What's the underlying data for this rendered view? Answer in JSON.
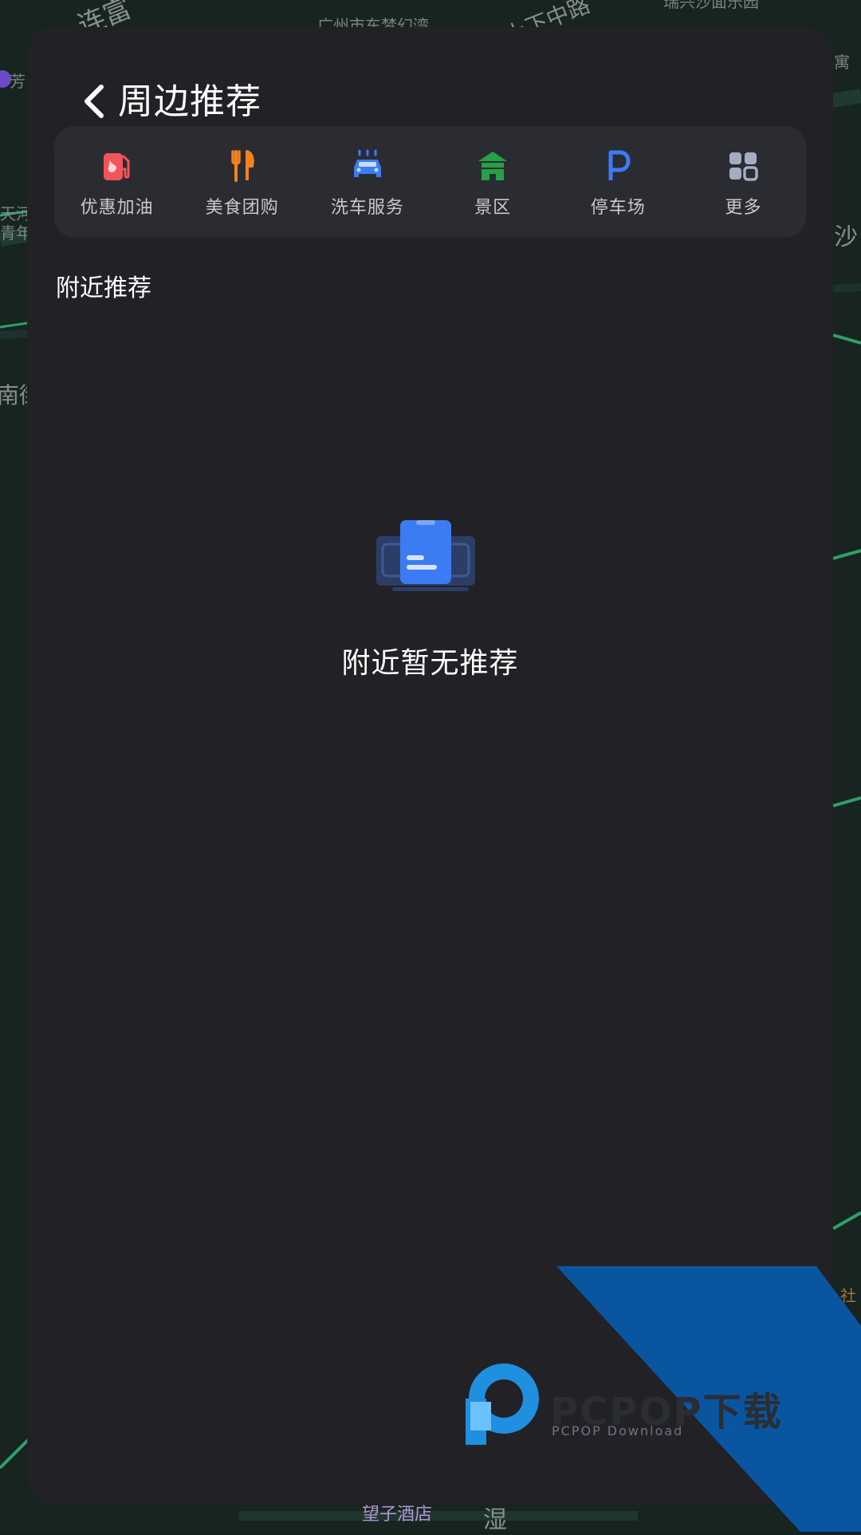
{
  "map": {
    "labels": [
      "连富",
      "广州市东梦幻湾",
      "上下中路",
      "瑞兴沙面乐园",
      "芳",
      "寓",
      "天河",
      "青年",
      "南街",
      "沙",
      "社",
      "湿",
      "望子酒店"
    ]
  },
  "header": {
    "back_icon": "chevron-left-icon",
    "title": "周边推荐"
  },
  "categories": [
    {
      "label": "优惠加油",
      "icon": "fuel-pump-icon",
      "color": "#f2545b"
    },
    {
      "label": "美食团购",
      "icon": "fork-knife-icon",
      "color": "#f5821f"
    },
    {
      "label": "洗车服务",
      "icon": "car-wash-icon",
      "color": "#3b7cf5"
    },
    {
      "label": "景区",
      "icon": "pavilion-icon",
      "color": "#27a047"
    },
    {
      "label": "停车场",
      "icon": "parking-icon",
      "color": "#3b7cf5"
    },
    {
      "label": "更多",
      "icon": "grid-icon",
      "color": "#a6acc2"
    }
  ],
  "section": {
    "title": "附近推荐"
  },
  "empty_state": {
    "icon": "empty-document-icon",
    "message": "附近暂无推荐"
  },
  "watermark": {
    "brand": "PCPOP下载",
    "subtitle": "PCPOP Download",
    "logo_color": "#1f8fe0",
    "band_color": "#0a55a0"
  }
}
